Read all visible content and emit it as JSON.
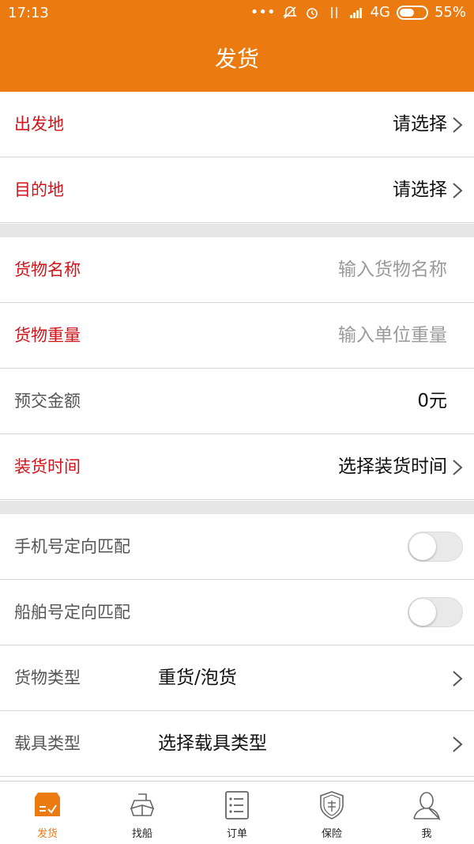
{
  "status": {
    "time": "17:13",
    "network": "4G",
    "battery": "55%",
    "battery_level": 0.55
  },
  "header": {
    "title": "发货"
  },
  "form": {
    "origin": {
      "label": "出发地",
      "value": "请选择"
    },
    "destination": {
      "label": "目的地",
      "value": "请选择"
    },
    "cargo_name": {
      "label": "货物名称",
      "placeholder": "输入货物名称"
    },
    "cargo_weight": {
      "label": "货物重量",
      "placeholder": "输入单位重量"
    },
    "deposit": {
      "label": "预交金额",
      "value": "0元"
    },
    "loading_time": {
      "label": "装货时间",
      "value": "选择装货时间"
    },
    "phone_match": {
      "label": "手机号定向匹配",
      "enabled": false
    },
    "ship_match": {
      "label": "船舶号定向匹配",
      "enabled": false
    },
    "cargo_type": {
      "label": "货物类型",
      "value": "重货/泡货"
    },
    "vehicle_type": {
      "label": "载具类型",
      "value": "选择载具类型"
    }
  },
  "tabs": [
    {
      "label": "发货",
      "icon": "ship-cargo-icon",
      "active": true
    },
    {
      "label": "找船",
      "icon": "ship-icon",
      "active": false
    },
    {
      "label": "订单",
      "icon": "order-list-icon",
      "active": false
    },
    {
      "label": "保险",
      "icon": "insurance-shield-icon",
      "active": false
    },
    {
      "label": "我",
      "icon": "user-icon",
      "active": false
    }
  ],
  "colors": {
    "accent": "#eb7a10",
    "required": "#d2131a",
    "placeholder": "#9a9a9a"
  }
}
